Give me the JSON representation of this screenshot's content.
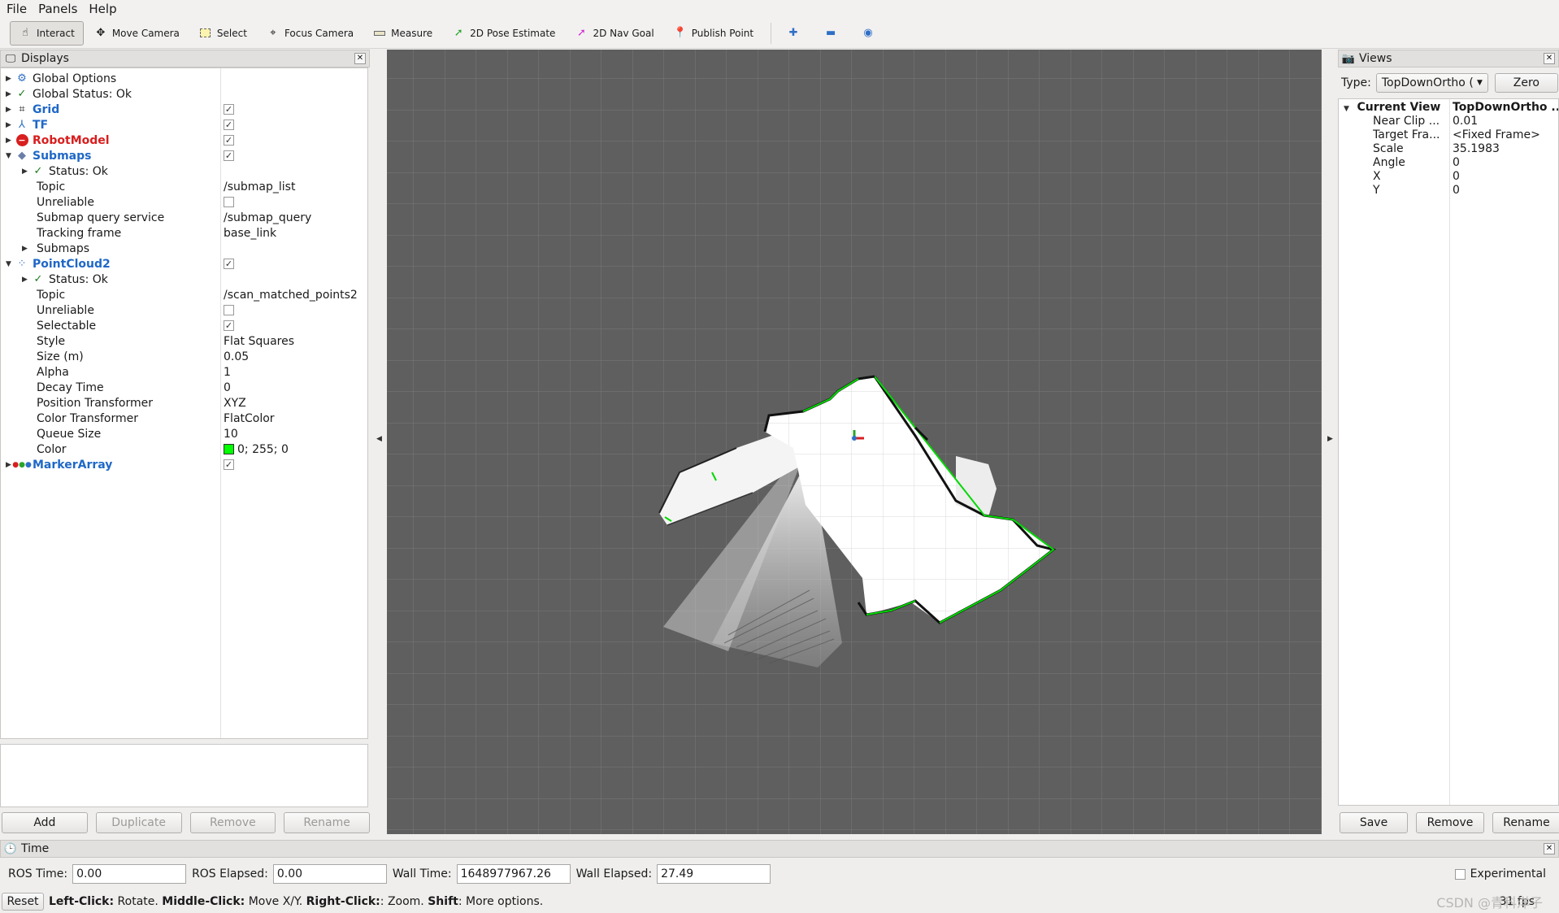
{
  "menu": {
    "file": "File",
    "panels": "Panels",
    "help": "Help"
  },
  "toolbar": {
    "interact": "Interact",
    "move_camera": "Move Camera",
    "select": "Select",
    "focus_camera": "Focus Camera",
    "measure": "Measure",
    "pose_estimate": "2D Pose Estimate",
    "nav_goal": "2D Nav Goal",
    "publish_point": "Publish Point"
  },
  "displays": {
    "title": "Displays",
    "rows": {
      "global_options": "Global Options",
      "global_status": "Global Status: Ok",
      "grid": "Grid",
      "tf": "TF",
      "robot_model": "RobotModel",
      "submaps": "Submaps",
      "submaps_status": "Status: Ok",
      "submaps_topic": "Topic",
      "submaps_topic_val": "/submap_list",
      "submaps_unreliable": "Unreliable",
      "submaps_query": "Submap query service",
      "submaps_query_val": "/submap_query",
      "submaps_tracking": "Tracking frame",
      "submaps_tracking_val": "base_link",
      "submaps_sub": "Submaps",
      "pointcloud": "PointCloud2",
      "pc_status": "Status: Ok",
      "pc_topic": "Topic",
      "pc_topic_val": "/scan_matched_points2",
      "pc_unreliable": "Unreliable",
      "pc_selectable": "Selectable",
      "pc_style": "Style",
      "pc_style_val": "Flat Squares",
      "pc_size": "Size (m)",
      "pc_size_val": "0.05",
      "pc_alpha": "Alpha",
      "pc_alpha_val": "1",
      "pc_decay": "Decay Time",
      "pc_decay_val": "0",
      "pc_pos_tf": "Position Transformer",
      "pc_pos_tf_val": "XYZ",
      "pc_color_tf": "Color Transformer",
      "pc_color_tf_val": "FlatColor",
      "pc_queue": "Queue Size",
      "pc_queue_val": "10",
      "pc_color": "Color",
      "pc_color_val": "0; 255; 0",
      "marker_array": "MarkerArray"
    },
    "buttons": {
      "add": "Add",
      "duplicate": "Duplicate",
      "remove": "Remove",
      "rename": "Rename"
    }
  },
  "views": {
    "title": "Views",
    "type_label": "Type:",
    "type_value": "TopDownOrtho (",
    "zero": "Zero",
    "rows": {
      "current_view": "Current View",
      "current_view_val": "TopDownOrtho ...",
      "near_clip": "Near Clip ...",
      "near_clip_val": "0.01",
      "target_frame": "Target Fra...",
      "target_frame_val": "<Fixed Frame>",
      "scale": "Scale",
      "scale_val": "35.1983",
      "angle": "Angle",
      "angle_val": "0",
      "x": "X",
      "x_val": "0",
      "y": "Y",
      "y_val": "0"
    },
    "buttons": {
      "save": "Save",
      "remove": "Remove",
      "rename": "Rename"
    }
  },
  "time": {
    "title": "Time",
    "ros_time_label": "ROS Time:",
    "ros_time": "0.00",
    "ros_elapsed_label": "ROS Elapsed:",
    "ros_elapsed": "0.00",
    "wall_time_label": "Wall Time:",
    "wall_time": "1648977967.26",
    "wall_elapsed_label": "Wall Elapsed:",
    "wall_elapsed": "27.49",
    "experimental": "Experimental"
  },
  "status": {
    "reset": "Reset",
    "left_click": "Left-Click:",
    "left_click_desc": " Rotate. ",
    "middle_click": "Middle-Click:",
    "middle_click_desc": " Move X/Y. ",
    "right_click": "Right-Click:",
    "right_click_desc": ": Zoom. ",
    "shift": "Shift",
    "shift_desc": ": More options.",
    "fps": "31 fps"
  },
  "watermark": "CSDN @青科洋子",
  "colors": {
    "pointcloud": "#00ff00",
    "viewport_bg": "#5f5f5f"
  }
}
